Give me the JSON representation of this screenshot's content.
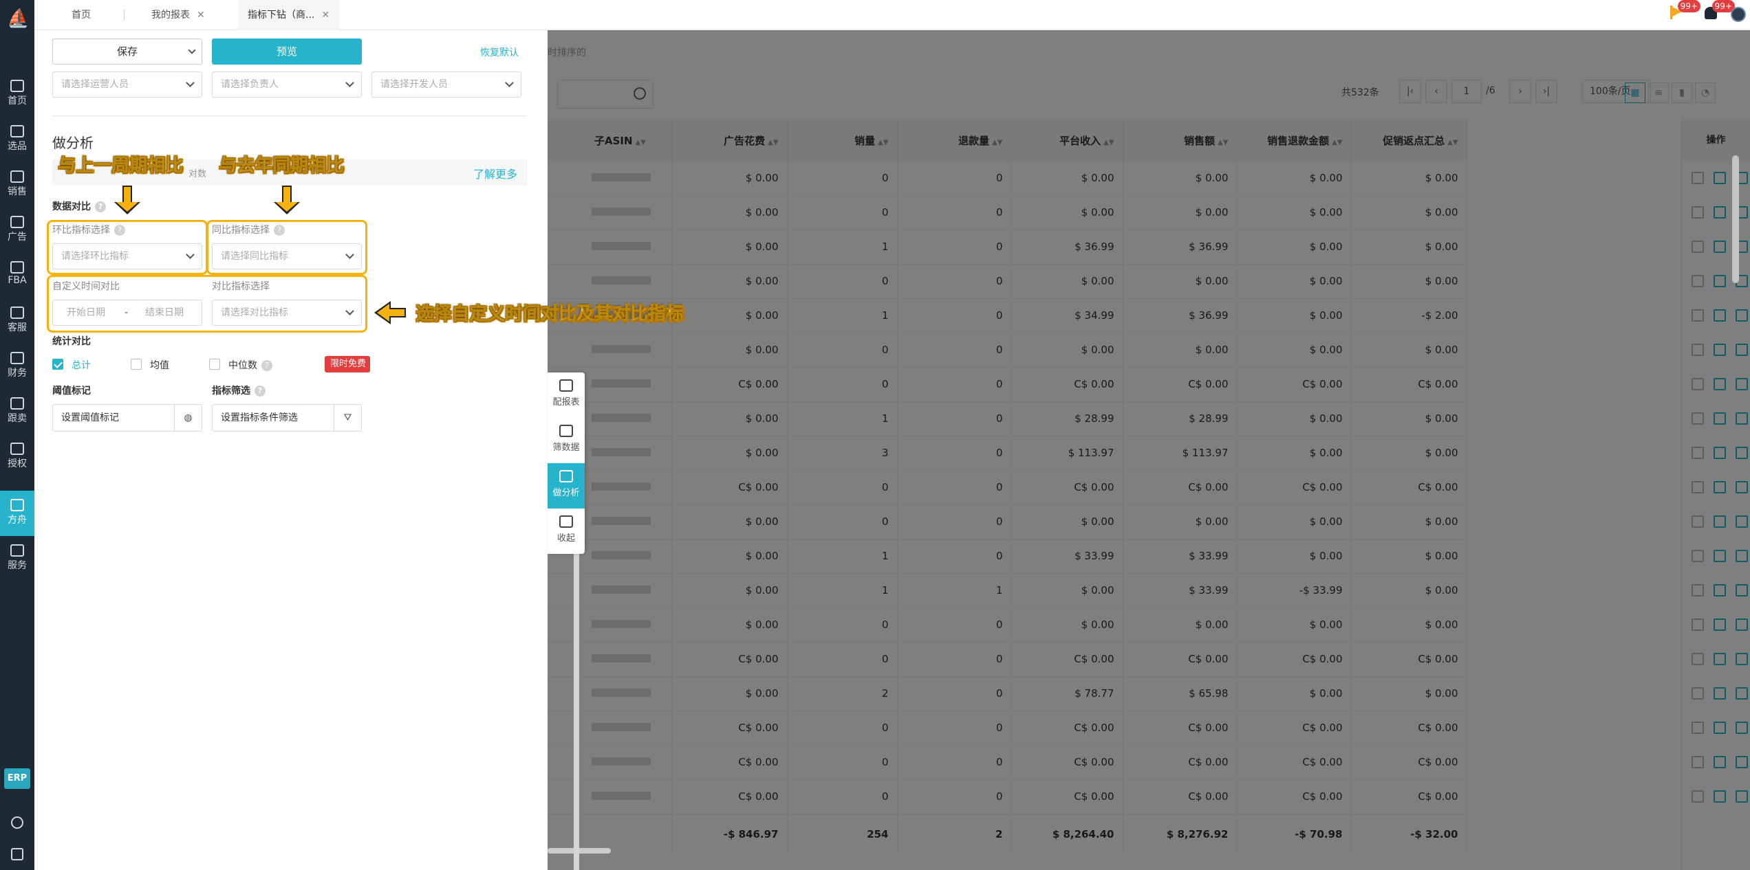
{
  "nav": {
    "items": [
      {
        "label": "首页",
        "icon": "home-icon"
      },
      {
        "label": "选品",
        "icon": "search-icon"
      },
      {
        "label": "销售",
        "icon": "chart-line-icon"
      },
      {
        "label": "广告",
        "icon": "ad-icon"
      },
      {
        "label": "FBA",
        "icon": "warehouse-icon"
      },
      {
        "label": "客服",
        "icon": "service-icon"
      },
      {
        "label": "财务",
        "icon": "finance-icon"
      },
      {
        "label": "跟卖",
        "icon": "follow-sell-icon"
      },
      {
        "label": "授权",
        "icon": "shield-icon"
      },
      {
        "label": "方舟",
        "icon": "ark-icon"
      },
      {
        "label": "服务",
        "icon": "services-icon"
      }
    ],
    "active": "方舟",
    "erp": "ERP"
  },
  "tabs": [
    {
      "label": "首页"
    },
    {
      "label": "我的报表"
    },
    {
      "label": "指标下钻（商..."
    }
  ],
  "header": {
    "flag_badge": "99+",
    "bell_badge": "99+"
  },
  "drawer": {
    "save_label": "保存",
    "preview_label": "预览",
    "reset_label": "恢复默认",
    "filters": {
      "operator_placeholder": "请选择运营人员",
      "owner_placeholder": "请选择负责人",
      "developer_placeholder": "请选择开发人员"
    },
    "analysis_title": "做分析",
    "infobar_text": "对数",
    "learn_more": "了解更多",
    "data_compare_label": "数据对比",
    "mom_label": "环比指标选择",
    "mom_placeholder": "请选择环比指标",
    "yoy_label": "同比指标选择",
    "yoy_placeholder": "请选择同比指标",
    "custom_time_label": "自定义时间对比",
    "start_date": "开始日期",
    "date_sep": "-",
    "end_date": "结束日期",
    "compare_metric_label": "对比指标选择",
    "compare_metric_placeholder": "请选择对比指标",
    "stat_label": "统计对比",
    "stat_options": [
      {
        "label": "总计",
        "checked": true
      },
      {
        "label": "均值",
        "checked": false
      },
      {
        "label": "中位数",
        "checked": false
      }
    ],
    "free_badge": "限时免费",
    "threshold_label": "阈值标记",
    "threshold_placeholder": "设置阈值标记",
    "metric_filter_label": "指标筛选",
    "metric_filter_placeholder": "设置指标条件筛选"
  },
  "callouts": {
    "mom": "与上一周期相比",
    "yoy": "与去年同期相比",
    "custom": "选择自定义时间对比及其对比指标"
  },
  "float_panel": [
    {
      "label": "配报表",
      "icon": "pie-chart-icon"
    },
    {
      "label": "筛数据",
      "icon": "filter-data-icon"
    },
    {
      "label": "做分析",
      "icon": "analysis-icon"
    },
    {
      "label": "收起",
      "icon": "collapse-icon"
    }
  ],
  "table": {
    "hint": "时排序的",
    "total_count": "共532条",
    "page_current": "1",
    "page_total": "/6",
    "page_size": "100条/页",
    "columns": [
      "子ASIN",
      "广告花费",
      "销量",
      "退款量",
      "平台收入",
      "销售额",
      "销售退款金额",
      "促销返点汇总",
      "操作"
    ],
    "rows": [
      [
        "$ 0.00",
        "0",
        "0",
        "$ 0.00",
        "$ 0.00",
        "$ 0.00",
        "$ 0.00"
      ],
      [
        "$ 0.00",
        "0",
        "0",
        "$ 0.00",
        "$ 0.00",
        "$ 0.00",
        "$ 0.00"
      ],
      [
        "$ 0.00",
        "1",
        "0",
        "$ 36.99",
        "$ 36.99",
        "$ 0.00",
        "$ 0.00"
      ],
      [
        "$ 0.00",
        "0",
        "0",
        "$ 0.00",
        "$ 0.00",
        "$ 0.00",
        "$ 0.00"
      ],
      [
        "$ 0.00",
        "1",
        "0",
        "$ 34.99",
        "$ 36.99",
        "$ 0.00",
        "-$ 2.00"
      ],
      [
        "$ 0.00",
        "0",
        "0",
        "$ 0.00",
        "$ 0.00",
        "$ 0.00",
        "$ 0.00"
      ],
      [
        "C$ 0.00",
        "0",
        "0",
        "C$ 0.00",
        "C$ 0.00",
        "C$ 0.00",
        "C$ 0.00"
      ],
      [
        "$ 0.00",
        "1",
        "0",
        "$ 28.99",
        "$ 28.99",
        "$ 0.00",
        "$ 0.00"
      ],
      [
        "$ 0.00",
        "3",
        "0",
        "$ 113.97",
        "$ 113.97",
        "$ 0.00",
        "$ 0.00"
      ],
      [
        "C$ 0.00",
        "0",
        "0",
        "C$ 0.00",
        "C$ 0.00",
        "C$ 0.00",
        "C$ 0.00"
      ],
      [
        "$ 0.00",
        "0",
        "0",
        "$ 0.00",
        "$ 0.00",
        "$ 0.00",
        "$ 0.00"
      ],
      [
        "$ 0.00",
        "1",
        "0",
        "$ 33.99",
        "$ 33.99",
        "$ 0.00",
        "$ 0.00"
      ],
      [
        "$ 0.00",
        "1",
        "1",
        "$ 0.00",
        "$ 33.99",
        "-$ 33.99",
        "$ 0.00"
      ],
      [
        "$ 0.00",
        "0",
        "0",
        "$ 0.00",
        "$ 0.00",
        "$ 0.00",
        "$ 0.00"
      ],
      [
        "C$ 0.00",
        "0",
        "0",
        "C$ 0.00",
        "C$ 0.00",
        "C$ 0.00",
        "C$ 0.00"
      ],
      [
        "$ 0.00",
        "2",
        "0",
        "$ 78.77",
        "$ 65.98",
        "$ 0.00",
        "$ 0.00"
      ],
      [
        "C$ 0.00",
        "0",
        "0",
        "C$ 0.00",
        "C$ 0.00",
        "C$ 0.00",
        "C$ 0.00"
      ],
      [
        "C$ 0.00",
        "0",
        "0",
        "C$ 0.00",
        "C$ 0.00",
        "C$ 0.00",
        "C$ 0.00"
      ],
      [
        "C$ 0.00",
        "0",
        "0",
        "C$ 0.00",
        "C$ 0.00",
        "C$ 0.00",
        "C$ 0.00"
      ]
    ],
    "total": [
      "-$ 846.97",
      "254",
      "2",
      "$ 8,264.40",
      "$ 8,276.92",
      "-$ 70.98",
      "-$ 32.00"
    ]
  },
  "colors": {
    "accent": "#27b3cc",
    "nav_bg": "#1d2a36",
    "highlight": "#f5b10c",
    "badge": "#e43d3d"
  }
}
